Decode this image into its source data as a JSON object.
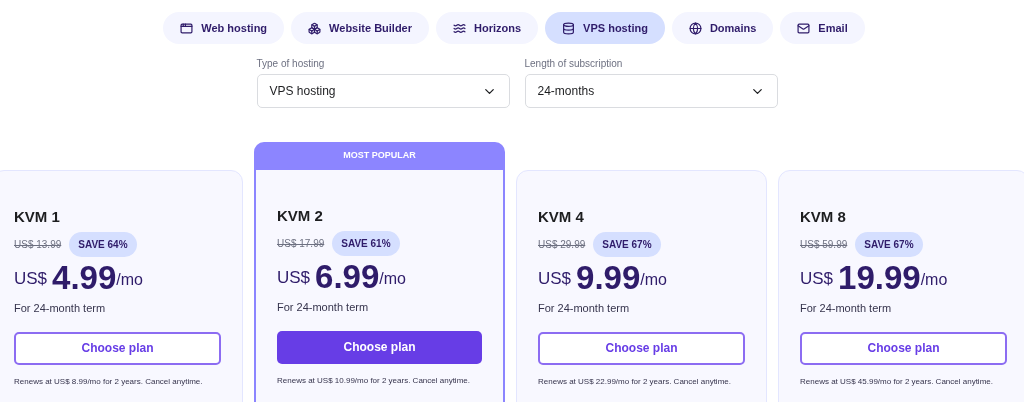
{
  "tabs": [
    {
      "label": "Web hosting",
      "kind": "hosting",
      "selected": false
    },
    {
      "label": "Website Builder",
      "kind": "builder",
      "selected": false
    },
    {
      "label": "Horizons",
      "kind": "ai",
      "selected": false
    },
    {
      "label": "VPS hosting",
      "kind": "vps",
      "selected": true
    },
    {
      "label": "Domains",
      "kind": "domains",
      "selected": false
    },
    {
      "label": "Email",
      "kind": "email",
      "selected": false
    }
  ],
  "filters": [
    {
      "label": "Type of hosting",
      "value": "VPS hosting"
    },
    {
      "label": "Length of subscription",
      "value": "24-months"
    }
  ],
  "plans": [
    {
      "name": "KVM 1",
      "featured": false,
      "old_price": "US$ 13.99",
      "save": "SAVE 64%",
      "currency": "US$",
      "price": "4.99",
      "unit": "/mo",
      "term": "For 24-month term",
      "button": "Choose plan",
      "renews": "Renews at US$ 8.99/mo for 2 years. Cancel anytime."
    },
    {
      "name": "KVM 2",
      "featured": true,
      "ribbon": "MOST POPULAR",
      "old_price": "US$ 17.99",
      "save": "SAVE 61%",
      "currency": "US$",
      "price": "6.99",
      "unit": "/mo",
      "term": "For 24-month term",
      "button": "Choose plan",
      "renews": "Renews at US$ 10.99/mo for 2 years. Cancel anytime."
    },
    {
      "name": "KVM 4",
      "featured": false,
      "old_price": "US$ 29.99",
      "save": "SAVE 67%",
      "currency": "US$",
      "price": "9.99",
      "unit": "/mo",
      "term": "For 24-month term",
      "button": "Choose plan",
      "renews": "Renews at US$ 22.99/mo for 2 years. Cancel anytime."
    },
    {
      "name": "KVM 8",
      "featured": false,
      "old_price": "US$ 59.99",
      "save": "SAVE 67%",
      "currency": "US$",
      "price": "19.99",
      "unit": "/mo",
      "term": "For 24-month term",
      "button": "Choose plan",
      "renews": "Renews at US$ 45.99/mo for 2 years. Cancel anytime."
    }
  ]
}
